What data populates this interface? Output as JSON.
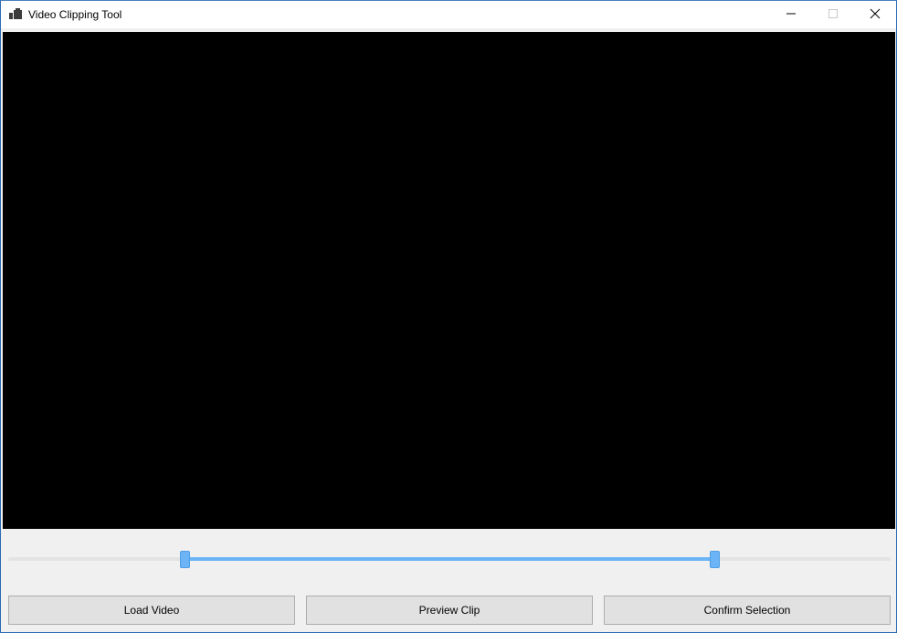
{
  "window": {
    "title": "Video Clipping Tool",
    "icon": "app-window-icon",
    "controls": {
      "minimize_icon": "minimize-icon",
      "maximize_icon": "maximize-icon",
      "close_icon": "close-icon"
    }
  },
  "video": {
    "background_color": "#000000"
  },
  "range_slider": {
    "start_fraction": 0.2,
    "end_fraction": 0.8,
    "fill_color": "#6cb4f5",
    "track_color": "#e3e3e3"
  },
  "buttons": {
    "load_video": "Load Video",
    "preview_clip": "Preview Clip",
    "confirm_selection": "Confirm Selection"
  }
}
